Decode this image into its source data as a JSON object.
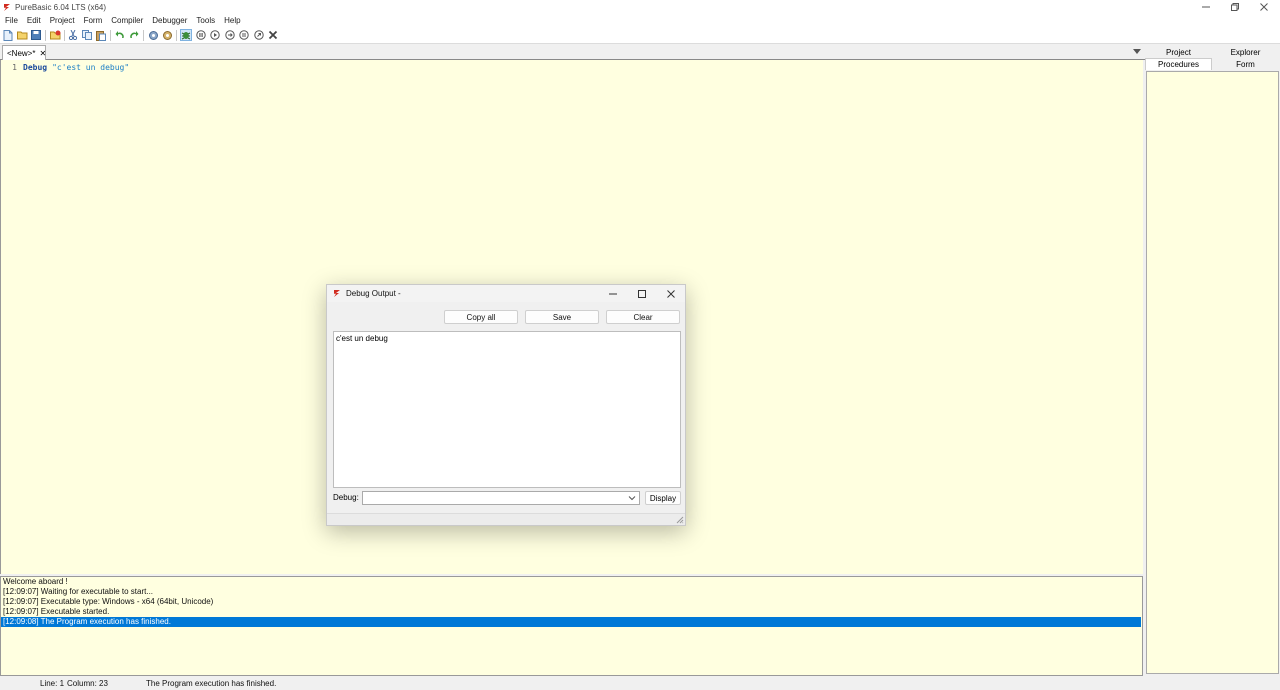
{
  "window": {
    "title": "PureBasic 6.04 LTS (x64)",
    "accent_color": "#0078d7"
  },
  "menu": {
    "items": [
      "File",
      "Edit",
      "Project",
      "Form",
      "Compiler",
      "Debugger",
      "Tools",
      "Help"
    ]
  },
  "toolbar": {
    "icons": [
      "new-file-icon",
      "open-file-icon",
      "save-icon",
      "close-file-icon",
      "cut-icon",
      "copy-icon",
      "paste-icon",
      "undo-icon",
      "redo-icon",
      "compile-icon",
      "compile-run-icon",
      "debugger-icon",
      "stop-icon",
      "step-icon",
      "step-over-icon",
      "step-out-icon",
      "continue-icon",
      "kill-icon"
    ]
  },
  "tabs": {
    "active_label": "<New>*",
    "close_glyph": "✕"
  },
  "editor": {
    "line_number": "1",
    "keyword": "Debug",
    "string": "\"c'est un debug\"",
    "background": "#ffffe0"
  },
  "right_panel": {
    "tabs": [
      "Project",
      "Explorer",
      "Procedures",
      "Form"
    ],
    "active_tab": "Procedures"
  },
  "log": {
    "lines": [
      "Welcome aboard !",
      "[12:09:07] Waiting for executable to start...",
      "[12:09:07] Executable type: Windows - x64  (64bit, Unicode)",
      "[12:09:07] Executable started.",
      "[12:09:08] The Program execution has finished."
    ],
    "selected_index": 4
  },
  "status": {
    "line": "Line: 1",
    "column": "Column: 23",
    "message": "The Program execution has finished."
  },
  "dialog": {
    "title": "Debug Output -",
    "copy_all_label": "Copy all",
    "save_label": "Save",
    "clear_label": "Clear",
    "output_text": "c'est un debug",
    "debug_label": "Debug:",
    "debug_value": "",
    "display_label": "Display"
  }
}
